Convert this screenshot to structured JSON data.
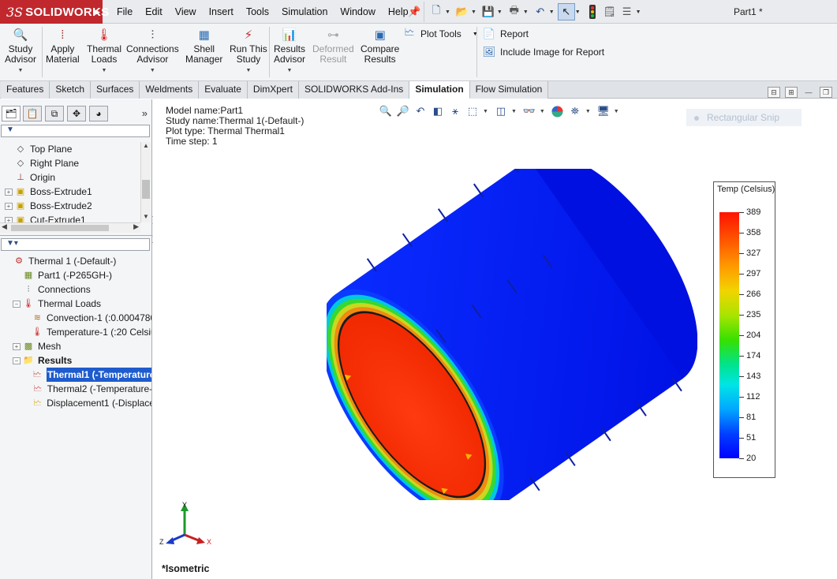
{
  "app": {
    "logo_text": "SOLIDWORKS",
    "logo_prefix": "3S",
    "document_title": "Part1 *",
    "menus": [
      "File",
      "Edit",
      "View",
      "Insert",
      "Tools",
      "Simulation",
      "Window",
      "Help"
    ]
  },
  "ribbon": {
    "study_advisor": [
      "Study",
      "Advisor"
    ],
    "apply_material": [
      "Apply",
      "Material"
    ],
    "thermal_loads": [
      "Thermal",
      "Loads"
    ],
    "connections_advisor": [
      "Connections",
      "Advisor"
    ],
    "shell_manager": [
      "Shell",
      "Manager"
    ],
    "run_this_study": [
      "Run This",
      "Study"
    ],
    "results_advisor": [
      "Results",
      "Advisor"
    ],
    "deformed_result": [
      "Deformed",
      "Result"
    ],
    "compare_results": [
      "Compare",
      "Results"
    ],
    "plot_tools": "Plot Tools",
    "report": "Report",
    "include_image": "Include Image for Report"
  },
  "tabs": [
    "Features",
    "Sketch",
    "Surfaces",
    "Weldments",
    "Evaluate",
    "DimXpert",
    "SOLIDWORKS Add-Ins",
    "Simulation",
    "Flow Simulation"
  ],
  "active_tab": "Simulation",
  "feature_tree": [
    {
      "label": "Top Plane",
      "icon": "plane-icon",
      "expand": false
    },
    {
      "label": "Right Plane",
      "icon": "plane-icon",
      "expand": false
    },
    {
      "label": "Origin",
      "icon": "origin-icon",
      "expand": false
    },
    {
      "label": "Boss-Extrude1",
      "icon": "extrude-icon",
      "expand": true
    },
    {
      "label": "Boss-Extrude2",
      "icon": "extrude-icon",
      "expand": true
    },
    {
      "label": "Cut-Extrude1",
      "icon": "extrude-icon",
      "expand": true
    }
  ],
  "simulation_tree": [
    {
      "label": "Thermal 1 (-Default-)",
      "icon": "thermal-study-icon",
      "level": 0,
      "expand": "none"
    },
    {
      "label": "Part1 (-P265GH-)",
      "icon": "part-icon",
      "level": 1,
      "expand": "none"
    },
    {
      "label": "Connections",
      "icon": "connections-icon",
      "level": 1,
      "expand": "none"
    },
    {
      "label": "Thermal Loads",
      "icon": "thermal-loads-icon",
      "level": 1,
      "expand": "minus"
    },
    {
      "label": "Convection-1 (:0.0004780",
      "icon": "convection-icon",
      "level": 2,
      "expand": "none"
    },
    {
      "label": "Temperature-1 (:20 Celsiu",
      "icon": "temperature-icon",
      "level": 2,
      "expand": "none"
    },
    {
      "label": "Mesh",
      "icon": "mesh-icon",
      "level": 1,
      "expand": "plus"
    },
    {
      "label": "Results",
      "icon": "results-folder-icon",
      "level": 1,
      "expand": "minus",
      "bold": true
    },
    {
      "label": "Thermal1 (-Temperature",
      "icon": "thermal-plot-icon",
      "level": 2,
      "expand": "none",
      "selected": true
    },
    {
      "label": "Thermal2 (-Temperature-",
      "icon": "thermal-plot-icon",
      "level": 2,
      "expand": "none"
    },
    {
      "label": "Displacement1 (-Displace",
      "icon": "displacement-plot-icon",
      "level": 2,
      "expand": "none"
    }
  ],
  "model_info": {
    "model_name": "Model name:Part1",
    "study_name": "Study name:Thermal 1(-Default-)",
    "plot_type": "Plot type: Thermal Thermal1",
    "time_step": "Time step: 1"
  },
  "snip_tooltip": "Rectangular Snip",
  "view_orientation": "*Isometric",
  "triad": {
    "y": "Y",
    "z": "Z",
    "x": "X"
  },
  "legend": {
    "title": "Temp (Celsius)",
    "values": [
      "389",
      "358",
      "327",
      "297",
      "266",
      "235",
      "204",
      "174",
      "143",
      "112",
      "81",
      "51",
      "20"
    ],
    "max": 389,
    "min": 20
  },
  "colors": {
    "logo_red": "#c0282d",
    "hot": "#ff2a00",
    "cold": "#0010ff",
    "selection": "#1e5ccd"
  }
}
